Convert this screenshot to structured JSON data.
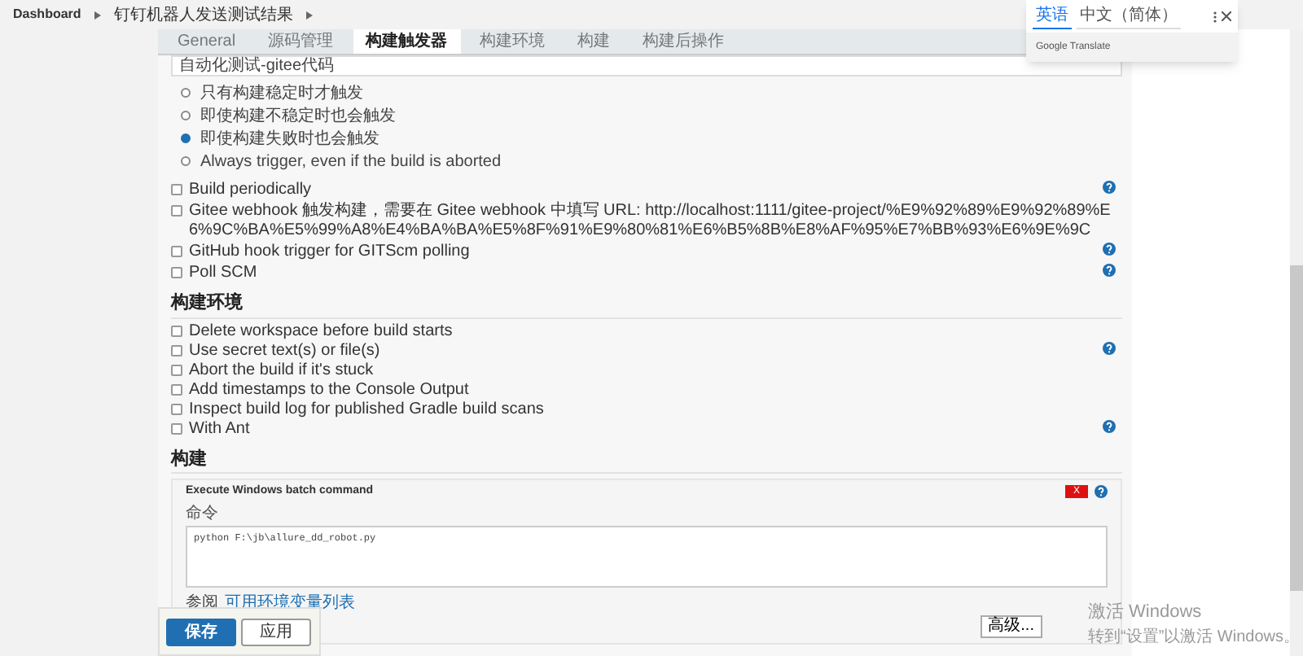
{
  "breadcrumb": [
    "Dashboard",
    "钉钉机器人发送测试结果"
  ],
  "tabs": [
    {
      "label": "General",
      "selected": false
    },
    {
      "label": "源码管理",
      "selected": false
    },
    {
      "label": "构建触发器",
      "selected": true
    },
    {
      "label": "构建环境",
      "selected": false
    },
    {
      "label": "构建",
      "selected": false
    },
    {
      "label": "构建后操作",
      "selected": false
    }
  ],
  "project_field": {
    "value": "自动化测试-gitee代码"
  },
  "trigger_options": [
    {
      "label": "只有构建稳定时才触发",
      "selected": false
    },
    {
      "label": "即使构建不稳定时也会触发",
      "selected": false
    },
    {
      "label": "即使构建失败时也会触发",
      "selected": true
    },
    {
      "label": "Always trigger, even if the build is aborted",
      "selected": false
    }
  ],
  "build_triggers": [
    {
      "label": "Build periodically",
      "checked": false,
      "help": true
    },
    {
      "label": "Gitee webhook 触发构建，需要在 Gitee webhook 中填写 URL: http://localhost:1111/gitee-project/%E9%92%89%E9%92%89%E6%9C%BA%E5%99%A8%E4%BA%BA%E5%8F%91%E9%80%81%E6%B5%8B%E8%AF%95%E7%BB%93%E6%9E%9C",
      "checked": false,
      "help": false
    },
    {
      "label": "GitHub hook trigger for GITScm polling",
      "checked": false,
      "help": true
    },
    {
      "label": "Poll SCM",
      "checked": false,
      "help": true
    }
  ],
  "build_env": {
    "title": "构建环境",
    "options": [
      {
        "label": "Delete workspace before build starts",
        "checked": false,
        "help": false
      },
      {
        "label": "Use secret text(s) or file(s)",
        "checked": false,
        "help": true
      },
      {
        "label": "Abort the build if it's stuck",
        "checked": false,
        "help": false
      },
      {
        "label": "Add timestamps to the Console Output",
        "checked": false,
        "help": false
      },
      {
        "label": "Inspect build log for published Gradle build scans",
        "checked": false,
        "help": false
      },
      {
        "label": "With Ant",
        "checked": false,
        "help": true
      }
    ]
  },
  "build": {
    "title": "构建",
    "step": {
      "title": "Execute Windows batch command",
      "delete": "X",
      "command_label": "命令",
      "command": "python F:\\jb\\allure_dd_robot.py",
      "see_prefix": "参阅",
      "see_link": "可用环境变量列表",
      "advanced": "高级..."
    }
  },
  "actions": {
    "save": "保存",
    "apply": "应用"
  },
  "translate_popup": {
    "tabs": [
      {
        "label": "英语",
        "selected": true
      },
      {
        "label": "中文（简体）",
        "selected": false
      }
    ],
    "footer": "Google Translate"
  },
  "os_notice": {
    "title": "激活 Windows",
    "text": "转到“设置”以激活 Windows。"
  }
}
